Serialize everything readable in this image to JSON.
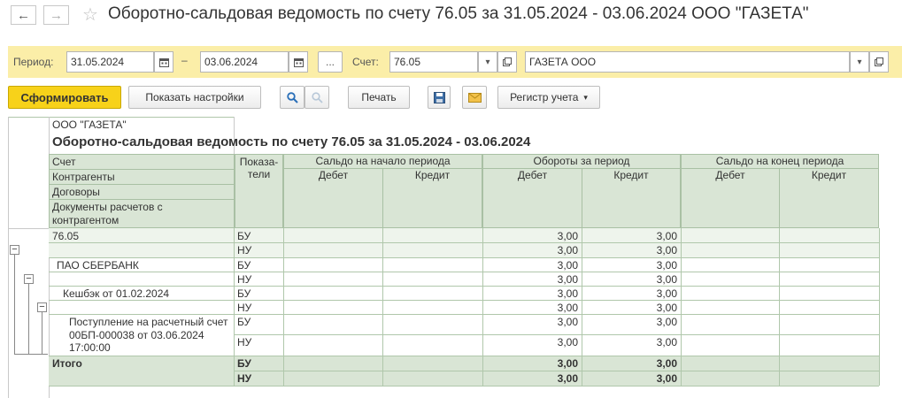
{
  "window": {
    "title": "Оборотно-сальдовая ведомость по счету 76.05 за 31.05.2024 - 03.06.2024 ООО \"ГАЗЕТА\"",
    "back_icon": "←",
    "forward_icon": "→",
    "star_icon": "☆"
  },
  "filters": {
    "period_label": "Период:",
    "date_from": "31.05.2024",
    "dash": "–",
    "date_to": "03.06.2024",
    "ellipsis": "...",
    "account_label": "Счет:",
    "account": "76.05",
    "organization": "ГАЗЕТА ООО"
  },
  "toolbar": {
    "generate": "Сформировать",
    "show_settings": "Показать настройки",
    "print": "Печать",
    "register": "Регистр учета"
  },
  "report": {
    "org": "ООО \"ГАЗЕТА\"",
    "title": "Оборотно-сальдовая ведомость по счету 76.05 за 31.05.2024 - 03.06.2024",
    "header": {
      "account": "Счет",
      "counterparties": "Контрагенты",
      "contracts": "Договоры",
      "documents": "Документы расчетов с контрагентом",
      "indicators": "Показа-тели",
      "opening": "Сальдо на начало периода",
      "turnover": "Обороты за период",
      "closing": "Сальдо на конец периода",
      "debit": "Дебет",
      "credit": "Кредит"
    },
    "rows": {
      "account_name": "76.05",
      "counterparty": "ПАО СБЕРБАНК",
      "contract": "Кешбэк от 01.02.2024",
      "document": "Поступление на расчетный счет 00БП-000038 от 03.06.2024 17:00:00",
      "total": "Итого",
      "bu": "БУ",
      "nu": "НУ",
      "turnover_debit": "3,00",
      "turnover_credit": "3,00"
    }
  }
}
